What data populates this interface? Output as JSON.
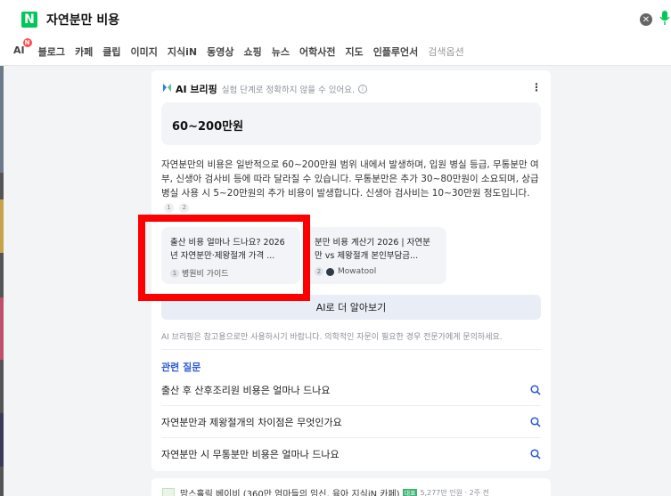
{
  "search": {
    "logo": "N",
    "query": "자연분만 비용"
  },
  "tabs": [
    {
      "label": "AI",
      "badge": "N"
    },
    {
      "label": "블로그"
    },
    {
      "label": "카페"
    },
    {
      "label": "클립"
    },
    {
      "label": "이미지"
    },
    {
      "label": "지식iN"
    },
    {
      "label": "동영상"
    },
    {
      "label": "쇼핑"
    },
    {
      "label": "뉴스"
    },
    {
      "label": "어학사전"
    },
    {
      "label": "지도"
    },
    {
      "label": "인플루언서"
    },
    {
      "label": "검색옵션"
    }
  ],
  "briefing": {
    "title": "AI 브리핑",
    "note": "실험 단계로 정확하지 않을 수 있어요.",
    "answer": "60~200만원",
    "summary": "자연분만의 비용은 일반적으로 60~200만원 범위 내에서 발생하며, 입원 병실 등급, 무통분만 여부, 신생아 검사비 등에 따라 달라질 수 있습니다. 무통분만은 추가 30~80만원이 소요되며, 상급병실 사용 시 5~20만원의 추가 비용이 발생합니다. 신생아 검사비는 10~30만원 정도입니다.",
    "citations": [
      "1",
      "2"
    ],
    "sources": [
      {
        "num": "1",
        "title": "출산 비용 얼마나 드나요? 2026년 자연분만·제왕절개 가격 ...",
        "site": "병원비 가이드"
      },
      {
        "num": "2",
        "title": "분만 비용 계산기 2026 | 자연분만 vs 제왕절개 본인부담금...",
        "site": "Mowatool"
      }
    ],
    "more_button": "AI로 더 알아보기",
    "disclaimer": "AI 브리핑은 참고용으로만 사용하시기 바랍니다. 의학적인 자문이 필요한 경우 전문가에게 문의하세요."
  },
  "related": {
    "title": "관련 질문",
    "items": [
      "출산 후 산후조리원 비용은 얼마나 드나요",
      "자연분만과 제왕절개의 차이점은 무엇인가요",
      "자연분만 시 무통분만 비용은 얼마나 드나요"
    ]
  },
  "next_result": {
    "title": "맘스홀릭 베이비 (360만 엄마들의 임신, 육아 지식iN 카페)",
    "badge": "대표",
    "meta": "5,277만 인원 · 2주 전"
  },
  "colors": {
    "naver_green": "#03c75a",
    "highlight": "#ff0000",
    "related_title": "#2a5bd7"
  }
}
